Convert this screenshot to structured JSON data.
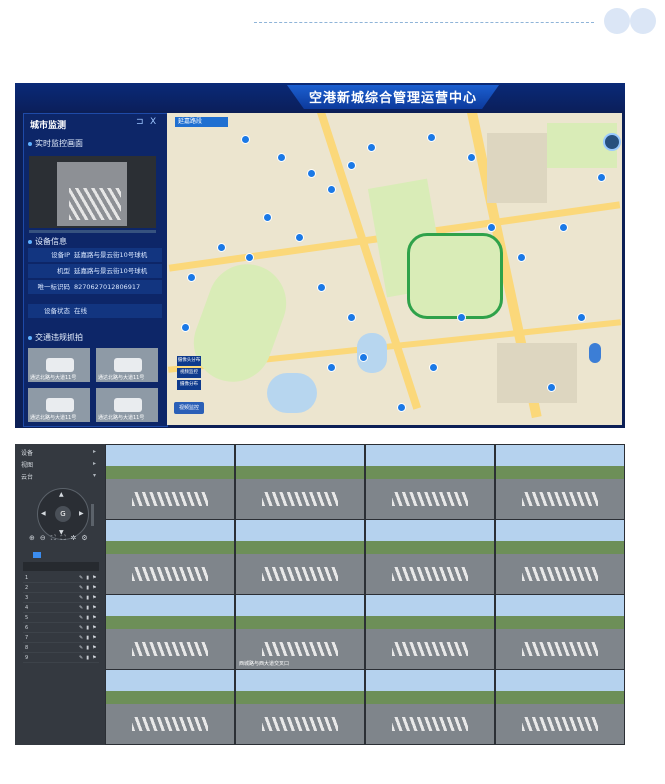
{
  "screen1": {
    "app_title": "空港新城综合管理运营中心",
    "panel": {
      "title": "城市监测",
      "ctrl_collapse": "⊐",
      "ctrl_close": "X",
      "sections": {
        "live": "实时监控画面",
        "device": "设备信息",
        "traffic": "交通违规抓拍"
      },
      "device_rows": [
        {
          "k": "设备IP",
          "v": "延嘉路与景云街10号球机"
        },
        {
          "k": "机型",
          "v": "延嘉路与景云街10号球机"
        },
        {
          "k": "唯一标识码",
          "v": "8270627012806917"
        },
        {
          "k": "设备状态",
          "v": "在线"
        }
      ],
      "thumb_caption": "通达北路与大道11号"
    },
    "map": {
      "tab": "延嘉路段",
      "menu": [
        "摄像头分布",
        "视频监控",
        "摄像分布"
      ],
      "button": "视频监控"
    }
  },
  "screen2": {
    "sidebar": {
      "items": [
        "设备",
        "视图",
        "云台"
      ],
      "ptz_center": "G",
      "tool_icons": "⊕⊖⛶⛶✲⚙"
    },
    "presets": [
      {
        "n": "1",
        "icons": "✎▮⚑"
      },
      {
        "n": "2",
        "icons": "✎▮⚑"
      },
      {
        "n": "3",
        "icons": "✎▮⚑"
      },
      {
        "n": "4",
        "icons": "✎▮⚑"
      },
      {
        "n": "5",
        "icons": "✎▮⚑"
      },
      {
        "n": "6",
        "icons": "✎▮⚑"
      },
      {
        "n": "7",
        "icons": "✎▮⚑"
      },
      {
        "n": "8",
        "icons": "✎▮⚑"
      },
      {
        "n": "9",
        "icons": "✎▮⚑"
      }
    ],
    "cams": [
      "",
      "",
      "",
      "",
      "",
      "",
      "",
      "",
      "",
      "西城路与西大道交叉口",
      "",
      "",
      "",
      "",
      "",
      ""
    ]
  }
}
